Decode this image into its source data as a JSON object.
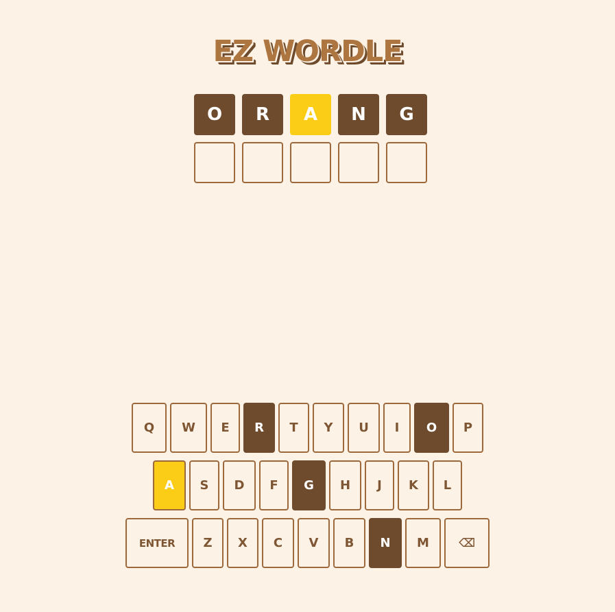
{
  "title": "EZ WORDLE",
  "grid": {
    "rows": [
      [
        {
          "letter": "O",
          "state": "absent"
        },
        {
          "letter": "R",
          "state": "absent"
        },
        {
          "letter": "A",
          "state": "present"
        },
        {
          "letter": "N",
          "state": "absent"
        },
        {
          "letter": "G",
          "state": "absent"
        }
      ],
      [
        {
          "letter": "",
          "state": "empty"
        },
        {
          "letter": "",
          "state": "empty"
        },
        {
          "letter": "",
          "state": "empty"
        },
        {
          "letter": "",
          "state": "empty"
        },
        {
          "letter": "",
          "state": "empty"
        }
      ]
    ]
  },
  "keyboard": {
    "row1": [
      {
        "label": "Q",
        "state": "unused"
      },
      {
        "label": "W",
        "state": "unused"
      },
      {
        "label": "E",
        "state": "unused"
      },
      {
        "label": "R",
        "state": "absent"
      },
      {
        "label": "T",
        "state": "unused"
      },
      {
        "label": "Y",
        "state": "unused"
      },
      {
        "label": "U",
        "state": "unused"
      },
      {
        "label": "I",
        "state": "unused"
      },
      {
        "label": "O",
        "state": "absent"
      },
      {
        "label": "P",
        "state": "unused"
      }
    ],
    "row2": [
      {
        "label": "A",
        "state": "present"
      },
      {
        "label": "S",
        "state": "unused"
      },
      {
        "label": "D",
        "state": "unused"
      },
      {
        "label": "F",
        "state": "unused"
      },
      {
        "label": "G",
        "state": "absent"
      },
      {
        "label": "H",
        "state": "unused"
      },
      {
        "label": "J",
        "state": "unused"
      },
      {
        "label": "K",
        "state": "unused"
      },
      {
        "label": "L",
        "state": "unused"
      }
    ],
    "row3": [
      {
        "label": "ENTER",
        "state": "unused"
      },
      {
        "label": "Z",
        "state": "unused"
      },
      {
        "label": "X",
        "state": "unused"
      },
      {
        "label": "C",
        "state": "unused"
      },
      {
        "label": "V",
        "state": "unused"
      },
      {
        "label": "B",
        "state": "unused"
      },
      {
        "label": "N",
        "state": "absent"
      },
      {
        "label": "M",
        "state": "unused"
      },
      {
        "label": "⌫",
        "state": "unused"
      }
    ]
  },
  "colors": {
    "background": "#fcf2e5",
    "absent": "#6e4b2c",
    "present": "#fbcd16",
    "border": "#9d693c",
    "key_text": "#7e5634"
  }
}
